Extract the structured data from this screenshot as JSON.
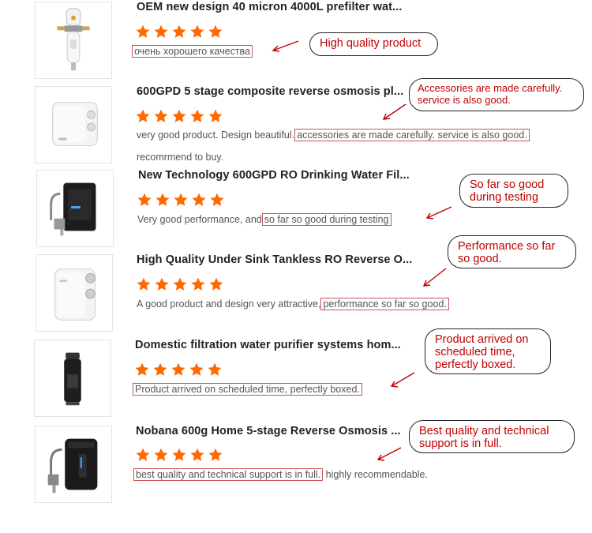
{
  "reviews": [
    {
      "title": "OEM new design 40 micron 4000L prefilter wat...",
      "stars": 5,
      "text_before": "",
      "text_highlight": "очень хорошего качества",
      "text_after": "",
      "callout": "High quality product"
    },
    {
      "title": "600GPD 5 stage composite reverse osmosis pl...",
      "stars": 5,
      "text_before": "very good product. Design beautiful.",
      "text_highlight": "accessories are made carefully. service is also good.",
      "text_after": "",
      "text_line2": "recomrmend to buy.",
      "callout": "Accessories are made carefully. service is also good."
    },
    {
      "title": "New Technology 600GPD RO Drinking Water Fil...",
      "stars": 5,
      "text_before": "Very good performance, and",
      "text_highlight": "so far so good during testing",
      "text_after": "",
      "callout": "So far so good during testing"
    },
    {
      "title": "High Quality Under Sink Tankless RO Reverse O...",
      "stars": 5,
      "text_before": "A good product and design very attractive,",
      "text_highlight": "performance so far so good.",
      "text_after": "",
      "callout": "Performance so far so good."
    },
    {
      "title": "Domestic filtration water purifier systems hom...",
      "stars": 5,
      "text_before": "",
      "text_highlight": "Product arrived on scheduled time, perfectly boxed.",
      "text_after": "",
      "callout": "Product arrived on scheduled time, perfectly boxed."
    },
    {
      "title": "Nobana 600g Home 5-stage Reverse Osmosis ...",
      "stars": 5,
      "text_before": "",
      "text_highlight": "best quality and technical support is in full.",
      "text_after": " highly recommendable.",
      "callout": "Best quality and technical support is in full."
    }
  ],
  "colors": {
    "star": "#ff6a00",
    "highlight_border": "#c9545a",
    "callout_text": "#c00000",
    "arrow": "#c00000"
  },
  "icons": [
    "star-icon",
    "arrow-icon",
    "product-image"
  ]
}
